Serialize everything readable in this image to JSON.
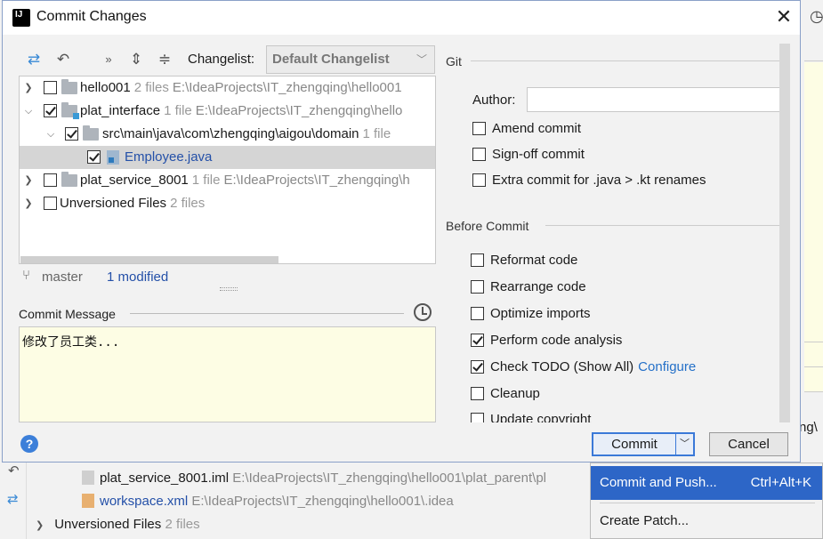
{
  "dialog": {
    "title": "Commit Changes"
  },
  "toolbar": {
    "changelist_label": "Changelist:",
    "changelist_value": "Default Changelist"
  },
  "tree": [
    {
      "name": "hello001",
      "count": "2 files",
      "path": "E:\\IdeaProjects\\IT_zhengqing\\hello001",
      "checked": false
    },
    {
      "name": "plat_interface",
      "count": "1 file",
      "path": "E:\\IdeaProjects\\IT_zhengqing\\hello",
      "checked": true
    },
    {
      "name": "src\\main\\java\\com\\zhengqing\\aigou\\domain",
      "count": "1 file",
      "checked": true
    },
    {
      "name": "Employee.java",
      "checked": true
    },
    {
      "name": "plat_service_8001",
      "count": "1 file",
      "path": "E:\\IdeaProjects\\IT_zhengqing\\h",
      "checked": false
    },
    {
      "name": "Unversioned Files",
      "count": "2 files",
      "checked": false
    }
  ],
  "status": {
    "branch": "master",
    "modified": "1 modified"
  },
  "commit_message": {
    "label": "Commit Message",
    "value": "修改了员工类..."
  },
  "git": {
    "section_title": "Git",
    "author_label": "Author:",
    "options": [
      "Amend commit",
      "Sign-off commit",
      "Extra commit for .java > .kt renames"
    ]
  },
  "before_commit": {
    "section_title": "Before Commit",
    "options": [
      {
        "label": "Reformat code",
        "checked": false
      },
      {
        "label": "Rearrange code",
        "checked": false
      },
      {
        "label": "Optimize imports",
        "checked": false
      },
      {
        "label": "Perform code analysis",
        "checked": true
      },
      {
        "label": "Check TODO (Show All)",
        "checked": true,
        "link": "Configure"
      },
      {
        "label": "Cleanup",
        "checked": false
      },
      {
        "label": "Update copyright",
        "checked": false
      }
    ]
  },
  "buttons": {
    "help": "?",
    "commit": "Commit",
    "cancel": "Cancel"
  },
  "popup": {
    "items": [
      {
        "label": "Commit and Push...",
        "shortcut": "Ctrl+Alt+K"
      },
      {
        "label": "Create Patch..."
      }
    ]
  },
  "background": {
    "rows": [
      {
        "name": "plat_service_8001.iml",
        "path": "E:\\IdeaProjects\\IT_zhengqing\\hello001\\plat_parent\\pl"
      },
      {
        "name": "workspace.xml",
        "path": "E:\\IdeaProjects\\IT_zhengqing\\hello001\\.idea"
      },
      {
        "name": "Unversioned Files",
        "count": "2 files"
      }
    ],
    "right_box_text": "ng\\"
  },
  "colors": {
    "accent": "#2d66c7",
    "link": "#2470c8",
    "message_bg": "#fdfde4"
  }
}
